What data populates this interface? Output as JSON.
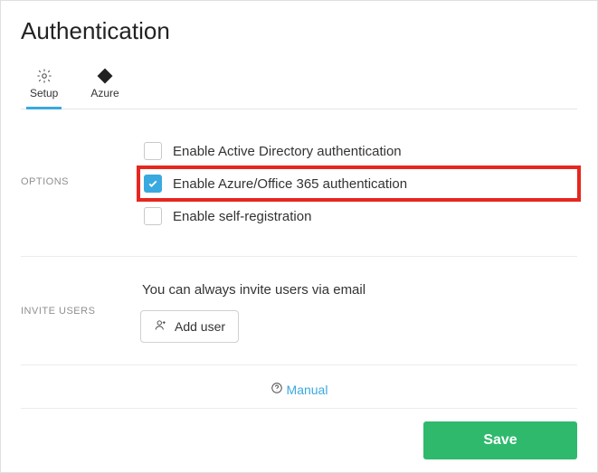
{
  "title": "Authentication",
  "tabs": {
    "setup": "Setup",
    "azure": "Azure",
    "active": 0
  },
  "options": {
    "section_label": "OPTIONS",
    "items": [
      {
        "label": "Enable Active Directory authentication",
        "checked": false,
        "highlight": false
      },
      {
        "label": "Enable Azure/Office 365 authentication",
        "checked": true,
        "highlight": true
      },
      {
        "label": "Enable self-registration",
        "checked": false,
        "highlight": false
      }
    ]
  },
  "invite": {
    "section_label": "INVITE USERS",
    "hint": "You can always invite users via email",
    "button": "Add user"
  },
  "manual_link": "Manual",
  "save_label": "Save",
  "colors": {
    "accent": "#3aa9e0",
    "save": "#2fb96c",
    "highlight_border": "#e6271f"
  }
}
